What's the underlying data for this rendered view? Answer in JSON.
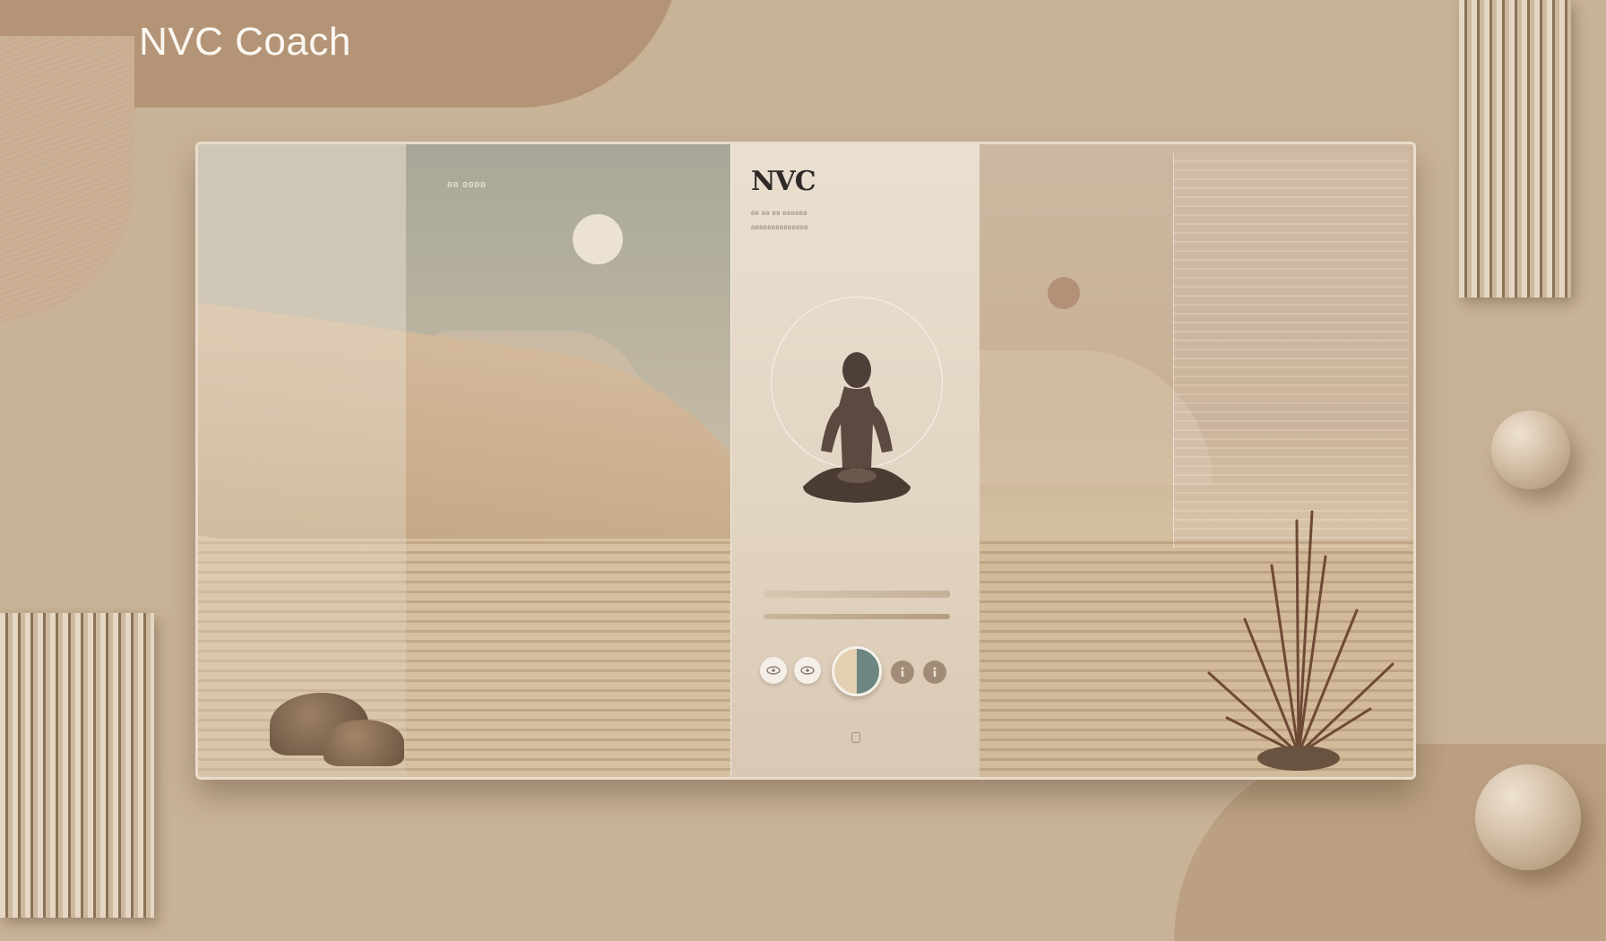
{
  "app": {
    "title": "NVC Coach"
  },
  "left_scene": {
    "label": "ʚʚ ʚʚʚʚ"
  },
  "card": {
    "logo": "NVC",
    "subtitle_line_1": "ʚʚ ʚʚ ʚʚ ʚʚʚʚʚʚ",
    "subtitle_line_2": "ʚʚʚʚʚʚʚʚʚʚʚʚʚʚ"
  },
  "controls": [
    {
      "icon": "eye-icon"
    },
    {
      "icon": "eye-icon"
    },
    {
      "icon": "mood-toggle-icon"
    },
    {
      "icon": "info-icon"
    },
    {
      "icon": "info-icon"
    }
  ],
  "colors": {
    "background": "#c9b398",
    "panel_border": "#e9dccb",
    "card": "#eadfd0",
    "title_text": "#fbf7f1",
    "logo_text": "#2f2a28"
  }
}
